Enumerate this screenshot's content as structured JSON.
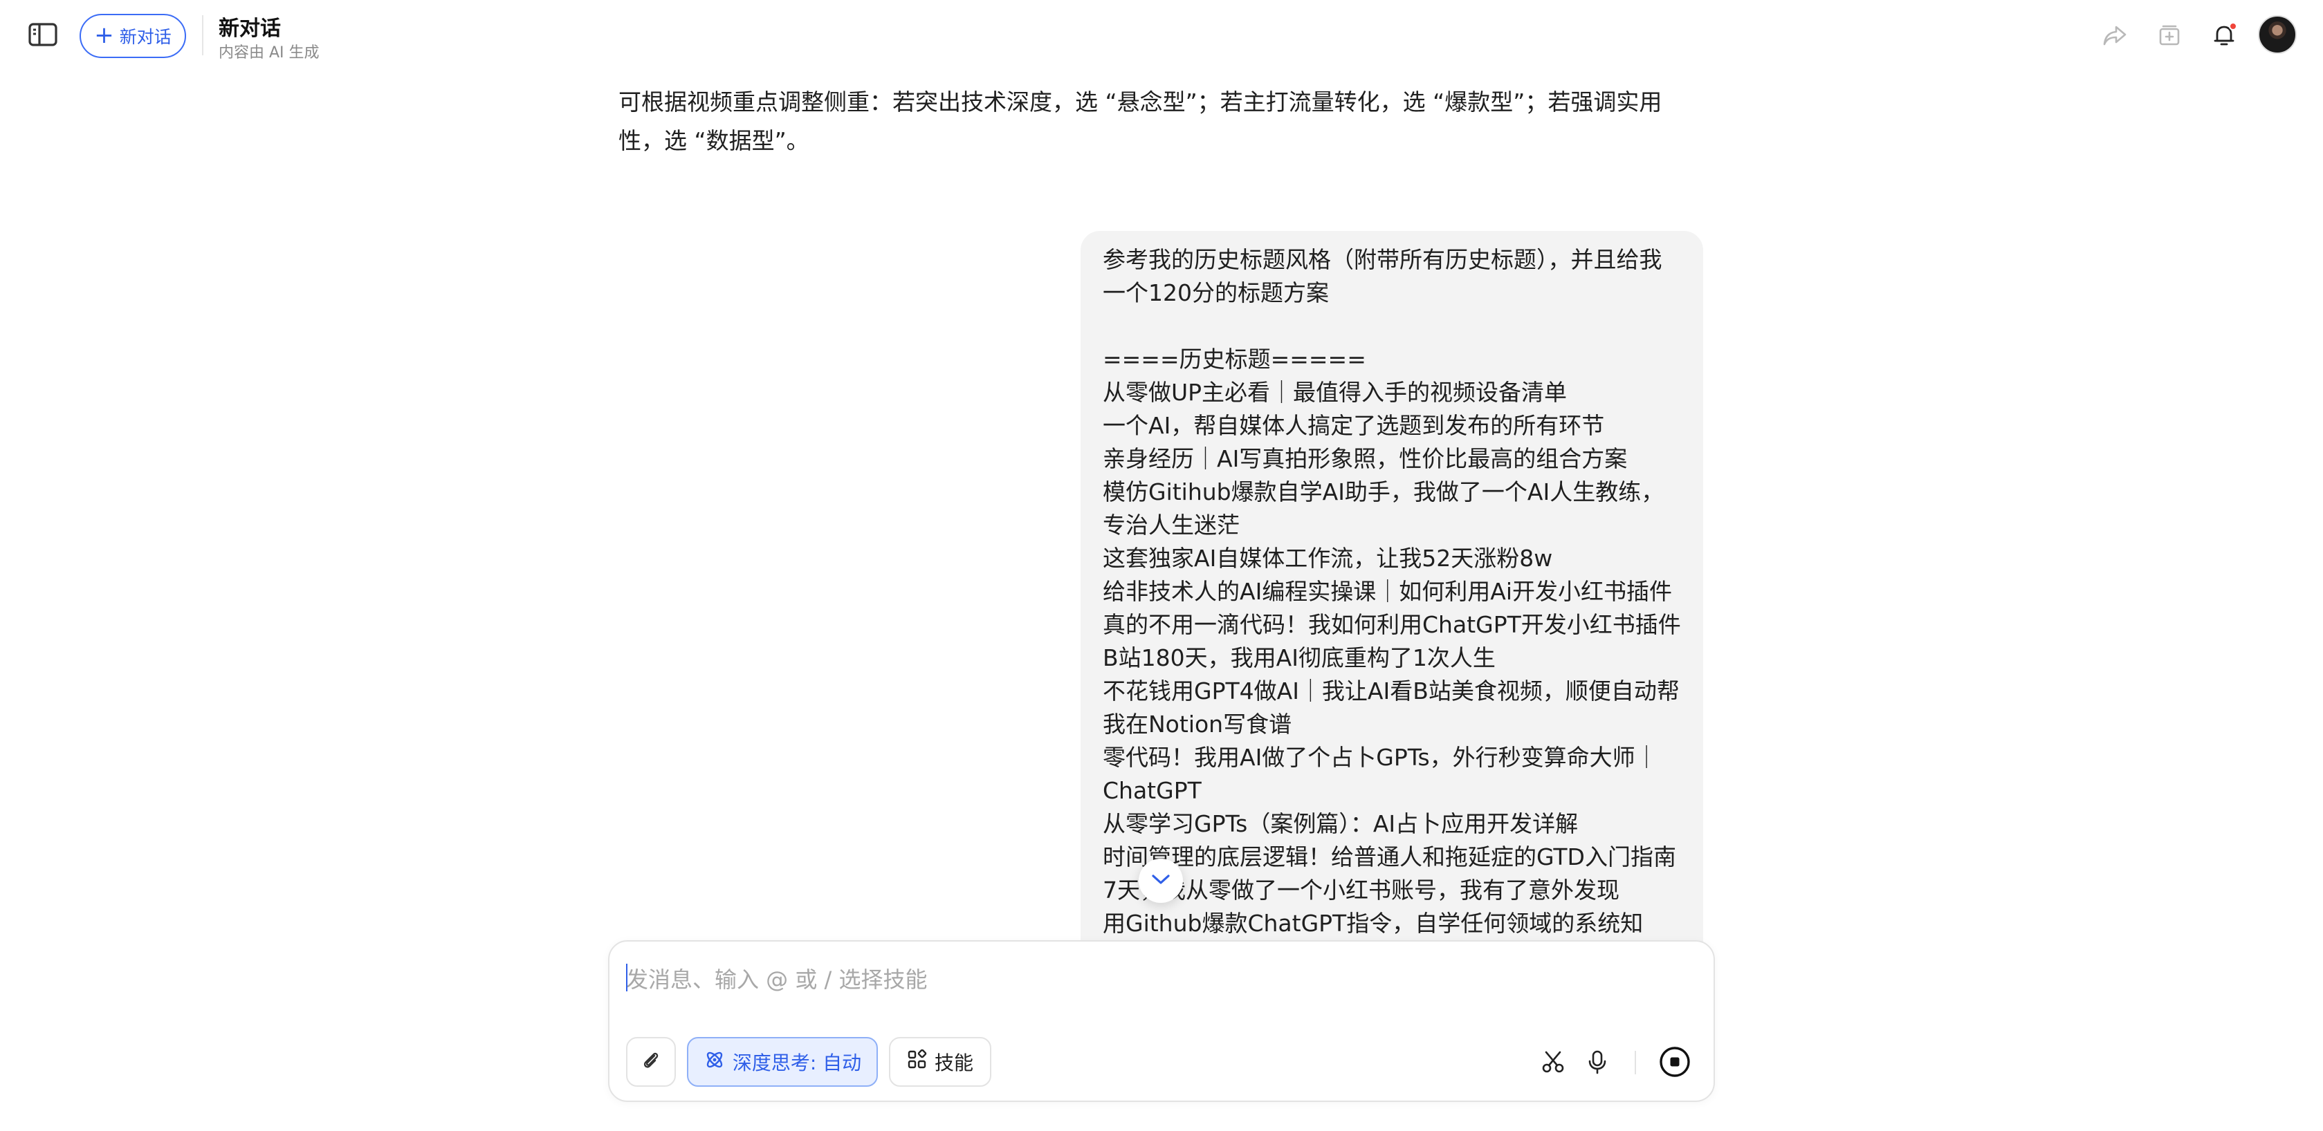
{
  "header": {
    "new_chat_label": "新对话",
    "title": "新对话",
    "subtitle": "内容由 AI 生成",
    "icons": [
      "sidebar-toggle-icon",
      "share-icon",
      "archive-icon",
      "bell-icon",
      "avatar"
    ]
  },
  "messages": {
    "ai_answer": "可根据视频重点调整侧重：若突出技术深度，选 “悬念型”；若主打流量转化，选 “爆款型”；若强调实用性，选 “数据型”。",
    "user_lines": [
      "参考我的历史标题风格（附带所有历史标题），并且给我一个120分的标题方案",
      "",
      "====历史标题=====",
      "从零做UP主必看｜最值得入手的视频设备清单",
      "一个AI，帮自媒体人搞定了选题到发布的所有环节",
      "亲身经历｜AI写真拍形象照，性价比最高的组合方案",
      "模仿Gitihub爆款自学AI助手，我做了一个AI人生教练，专治人生迷茫",
      "这套独家AI自媒体工作流，让我52天涨粉8w",
      "给非技术人的AI编程实操课｜如何利用Ai开发小红书插件",
      "真的不用一滴代码！我如何利用ChatGPT开发小红书插件",
      "B站180天，我用AI彻底重构了1次人生",
      "不花钱用GPT4做AI｜我让AI看B站美食视频，顺便自动帮我在Notion写食谱",
      "零代码！我用AI做了个占卜GPTs，外行秒变算命大师｜ChatGPT",
      "从零学习GPTs（案例篇）：AI占卜应用开发详解",
      "时间管理的底层逻辑！给普通人和拖延症的GTD入门指南",
      "7天，我从零做了一个小红书账号，我有了意外发现",
      "用Github爆款ChatGPT指令，自学任何领域的系统知识！AI"
    ]
  },
  "composer": {
    "placeholder": "发消息、输入 @ 或 / 选择技能",
    "deep_think_label": "深度思考: 自动",
    "skills_label": "技能"
  },
  "colors": {
    "accent": "#2f5fe8",
    "deep_think_bg": "#e8efff",
    "bubble_bg": "#f3f3f3",
    "notification_dot": "#f0443a"
  }
}
